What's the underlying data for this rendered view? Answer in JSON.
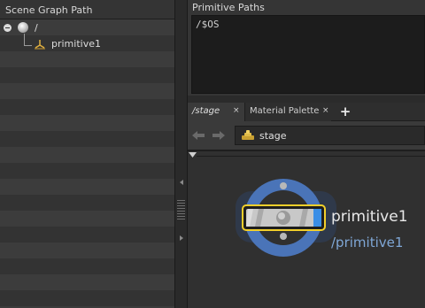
{
  "scene_graph": {
    "header": "Scene Graph Path",
    "items": [
      {
        "label": "/",
        "icon": "root-sphere-icon"
      },
      {
        "label": "primitive1",
        "icon": "xform-primitive-icon"
      }
    ]
  },
  "primitive_paths": {
    "header": "Primitive Paths",
    "value": "/$OS"
  },
  "tabs": [
    {
      "label": "/stage",
      "close": "×"
    },
    {
      "label": "Material Palette",
      "close": "×"
    }
  ],
  "add_tab": "+",
  "path_bar": {
    "back_icon": "back-arrow-icon",
    "forward_icon": "forward-arrow-icon",
    "location": "stage",
    "location_icon": "lop-network-icon"
  },
  "node": {
    "name": "primitive1",
    "path": "/primitive1",
    "colors": {
      "ring": "#4a74b8",
      "outline": "#f2cf2a",
      "flag": "#3a8ee6"
    }
  }
}
